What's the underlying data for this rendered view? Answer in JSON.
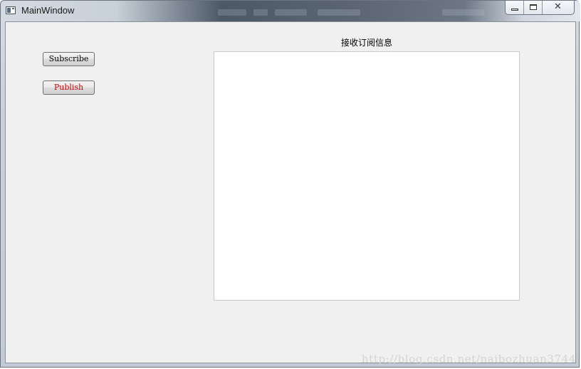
{
  "window": {
    "title": "MainWindow"
  },
  "caption": {
    "minimize_icon": "minimize-icon",
    "maximize_icon": "maximize-icon",
    "close_icon": "close-icon",
    "close_symbol": "✕"
  },
  "buttons": {
    "subscribe_label": "Subscribe",
    "publish_label": "Publish",
    "publish_text_color": "#cc0000"
  },
  "panel": {
    "label": "接收订阅信息",
    "content": ""
  },
  "watermark": {
    "text": "http://blog.csdn.net/naibozhuan3744"
  }
}
